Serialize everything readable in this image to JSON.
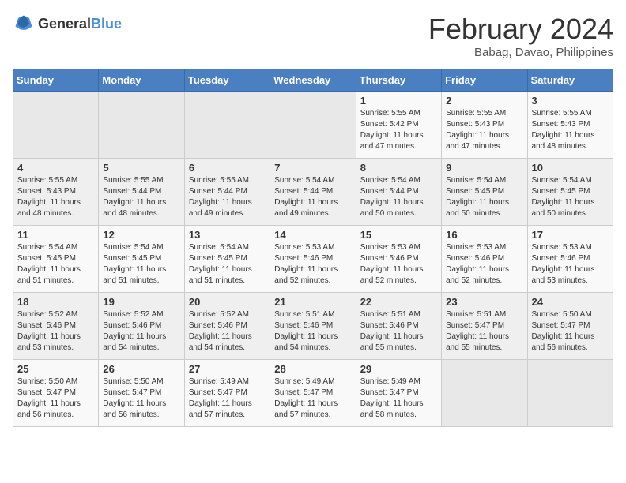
{
  "logo": {
    "general": "General",
    "blue": "Blue"
  },
  "title": "February 2024",
  "subtitle": "Babag, Davao, Philippines",
  "headers": [
    "Sunday",
    "Monday",
    "Tuesday",
    "Wednesday",
    "Thursday",
    "Friday",
    "Saturday"
  ],
  "weeks": [
    [
      {
        "num": "",
        "empty": true
      },
      {
        "num": "",
        "empty": true
      },
      {
        "num": "",
        "empty": true
      },
      {
        "num": "",
        "empty": true
      },
      {
        "num": "1",
        "sunrise": "5:55 AM",
        "sunset": "5:42 PM",
        "daylight": "11 hours and 47 minutes."
      },
      {
        "num": "2",
        "sunrise": "5:55 AM",
        "sunset": "5:43 PM",
        "daylight": "11 hours and 47 minutes."
      },
      {
        "num": "3",
        "sunrise": "5:55 AM",
        "sunset": "5:43 PM",
        "daylight": "11 hours and 48 minutes."
      }
    ],
    [
      {
        "num": "4",
        "sunrise": "5:55 AM",
        "sunset": "5:43 PM",
        "daylight": "11 hours and 48 minutes."
      },
      {
        "num": "5",
        "sunrise": "5:55 AM",
        "sunset": "5:44 PM",
        "daylight": "11 hours and 48 minutes."
      },
      {
        "num": "6",
        "sunrise": "5:55 AM",
        "sunset": "5:44 PM",
        "daylight": "11 hours and 49 minutes."
      },
      {
        "num": "7",
        "sunrise": "5:54 AM",
        "sunset": "5:44 PM",
        "daylight": "11 hours and 49 minutes."
      },
      {
        "num": "8",
        "sunrise": "5:54 AM",
        "sunset": "5:44 PM",
        "daylight": "11 hours and 50 minutes."
      },
      {
        "num": "9",
        "sunrise": "5:54 AM",
        "sunset": "5:45 PM",
        "daylight": "11 hours and 50 minutes."
      },
      {
        "num": "10",
        "sunrise": "5:54 AM",
        "sunset": "5:45 PM",
        "daylight": "11 hours and 50 minutes."
      }
    ],
    [
      {
        "num": "11",
        "sunrise": "5:54 AM",
        "sunset": "5:45 PM",
        "daylight": "11 hours and 51 minutes."
      },
      {
        "num": "12",
        "sunrise": "5:54 AM",
        "sunset": "5:45 PM",
        "daylight": "11 hours and 51 minutes."
      },
      {
        "num": "13",
        "sunrise": "5:54 AM",
        "sunset": "5:45 PM",
        "daylight": "11 hours and 51 minutes."
      },
      {
        "num": "14",
        "sunrise": "5:53 AM",
        "sunset": "5:46 PM",
        "daylight": "11 hours and 52 minutes."
      },
      {
        "num": "15",
        "sunrise": "5:53 AM",
        "sunset": "5:46 PM",
        "daylight": "11 hours and 52 minutes."
      },
      {
        "num": "16",
        "sunrise": "5:53 AM",
        "sunset": "5:46 PM",
        "daylight": "11 hours and 52 minutes."
      },
      {
        "num": "17",
        "sunrise": "5:53 AM",
        "sunset": "5:46 PM",
        "daylight": "11 hours and 53 minutes."
      }
    ],
    [
      {
        "num": "18",
        "sunrise": "5:52 AM",
        "sunset": "5:46 PM",
        "daylight": "11 hours and 53 minutes."
      },
      {
        "num": "19",
        "sunrise": "5:52 AM",
        "sunset": "5:46 PM",
        "daylight": "11 hours and 54 minutes."
      },
      {
        "num": "20",
        "sunrise": "5:52 AM",
        "sunset": "5:46 PM",
        "daylight": "11 hours and 54 minutes."
      },
      {
        "num": "21",
        "sunrise": "5:51 AM",
        "sunset": "5:46 PM",
        "daylight": "11 hours and 54 minutes."
      },
      {
        "num": "22",
        "sunrise": "5:51 AM",
        "sunset": "5:46 PM",
        "daylight": "11 hours and 55 minutes."
      },
      {
        "num": "23",
        "sunrise": "5:51 AM",
        "sunset": "5:47 PM",
        "daylight": "11 hours and 55 minutes."
      },
      {
        "num": "24",
        "sunrise": "5:50 AM",
        "sunset": "5:47 PM",
        "daylight": "11 hours and 56 minutes."
      }
    ],
    [
      {
        "num": "25",
        "sunrise": "5:50 AM",
        "sunset": "5:47 PM",
        "daylight": "11 hours and 56 minutes."
      },
      {
        "num": "26",
        "sunrise": "5:50 AM",
        "sunset": "5:47 PM",
        "daylight": "11 hours and 56 minutes."
      },
      {
        "num": "27",
        "sunrise": "5:49 AM",
        "sunset": "5:47 PM",
        "daylight": "11 hours and 57 minutes."
      },
      {
        "num": "28",
        "sunrise": "5:49 AM",
        "sunset": "5:47 PM",
        "daylight": "11 hours and 57 minutes."
      },
      {
        "num": "29",
        "sunrise": "5:49 AM",
        "sunset": "5:47 PM",
        "daylight": "11 hours and 58 minutes."
      },
      {
        "num": "",
        "empty": true
      },
      {
        "num": "",
        "empty": true
      }
    ]
  ],
  "cell_labels": {
    "sunrise": "Sunrise:",
    "sunset": "Sunset:",
    "daylight": "Daylight:"
  }
}
